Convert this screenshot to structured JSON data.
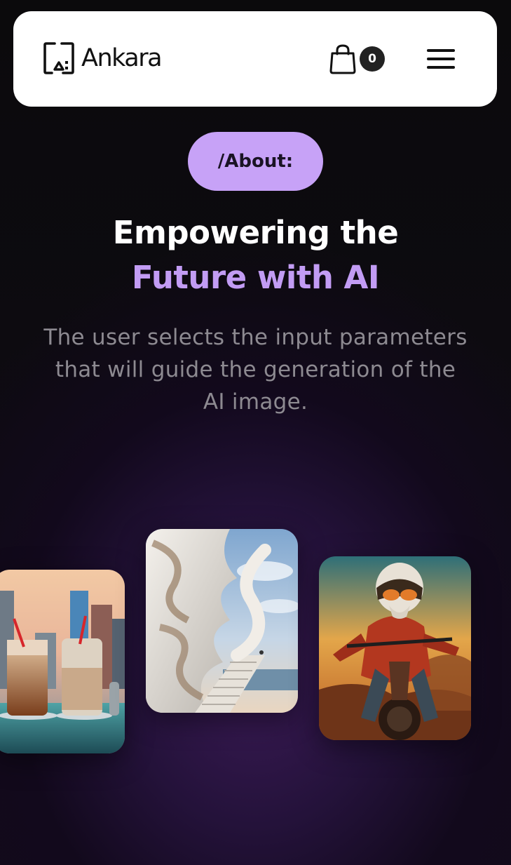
{
  "header": {
    "brand": "Ankara",
    "cart_count": "0",
    "logo_icon": "ankara-logo-icon",
    "cart_icon": "shopping-bag-icon",
    "menu_icon": "hamburger-menu-icon"
  },
  "hero": {
    "badge_label": "/About:",
    "headline_line1": "Empowering the",
    "headline_line2": "Future with AI",
    "subtitle": "The user selects the input parameters that will guide the generation of the AI image."
  },
  "gallery": {
    "images": [
      {
        "subject": "iced-coffee-drinks-image"
      },
      {
        "subject": "futuristic-architecture-image"
      },
      {
        "subject": "motocross-rider-image"
      }
    ]
  },
  "colors": {
    "accent": "#c7a2f7",
    "headline_accent": "#c29cf4",
    "background": "#0d0b10",
    "header_bg": "#ffffff"
  }
}
